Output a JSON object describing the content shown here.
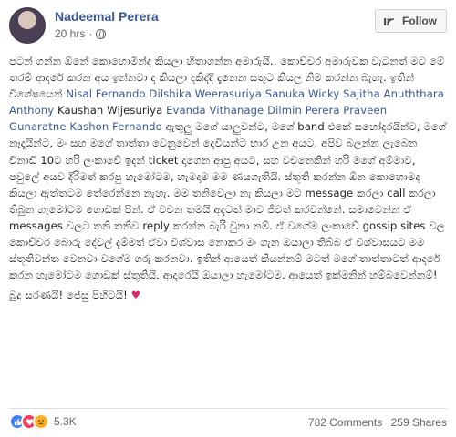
{
  "post": {
    "author": "Nadeemal Perera",
    "time": "20 hrs",
    "follow_label": "Follow",
    "paragraphs": {
      "p1_pre": "පටන් ගන්න ඕනේ කොහොමින්ද කියලා හිතාගන්න අමාරුයි.. කොච්චර අමාරුවක වැටුනත් මට මේ තරම් ආදරේ කරන අය ඉන්නවා ද කියලා දකිද්දී දැනෙන සතුට කියල නිම කරන්න බැහැ. ඉතින් විශේෂයෙන් ",
      "names1": "Nisal Fernando Dilshika Weerasuriya Sanuka Wicky Sajitha Anuththara Anthony",
      "plain1": " Kaushan Wijesuriya ",
      "names2": "Evanda Vithanage Dilmin Perera Praveen Gunaratne Kashon Fernando",
      "p1_post": " ඇතුලු මගේ යාලුවන්ට, මගේ band එකේ සහෝදරයින්ට, මගේ නෑදෑයින්ට, මං සහ මගේ තාත්තා වෙනුවෙන් දෙවියන්ට භාර උන අයට, අපිව බලන්න ලැබෙන විනාඩි 10ට හරි ලංකාවේ ඉදන් ticket දාගෙන ආපු අයට, සහ වචනෙකින් හරි මගේ අම්මාව, පවුලේ අයව දිරිමත් කරපු හැමෝටම, හැමදාම මම ණයගැතියි. ස්තූති කරන්න ඕන කොහොමද කියලා ඇත්තටම තේරෙන්නෙ නැහැ. මම තනිවෙලා නැ කියලා මට message කරලා call කරලා තිබුන හැමෝටම ගොඩක් පින්. ඒ වචන තමයි අදටත් මාව ජීවත් කරවන්නේ. සමාවෙන්න ඒ messages වලට තනි තනිව reply කරන්න බැරි වුනා නම්. ඒ වගේම ලංකාවේ gossip sites වල කොච්චර බොරු දේවල් දැම්මත් ඒවා විශ්වාස නොකර මං ගැන ඔයාලා තිබ්බ ඒ විශ්වාසයට මම ස්තූතිවන්ත වෙනවා වගේම ගරු කරනවා. ඉතින් ආයෙත් කියන්නම් මටත් මගේ තාත්තාටත් ආදරේ කරන හැමෝටම ගොඩක් ස්තූතියි. ආදරෙයි ඔයාලා හැමෝටම. ආයෙත් ඉක්මනින් හම්බවෙන්නම්!",
      "p2": "බුදු සරණයි! ජේසු පිහිටයි! ",
      "heart": "♥"
    },
    "reactions_count": "5.3K",
    "comments": "782 Comments",
    "shares": "259 Shares",
    "colors": {
      "link": "#385898",
      "like": "#4080ff",
      "love": "#f33e58",
      "sad": "#f7b125"
    },
    "icons": [
      "avatar",
      "globe-icon",
      "follow-icon",
      "like-reaction-icon",
      "love-reaction-icon",
      "sad-reaction-icon"
    ]
  }
}
